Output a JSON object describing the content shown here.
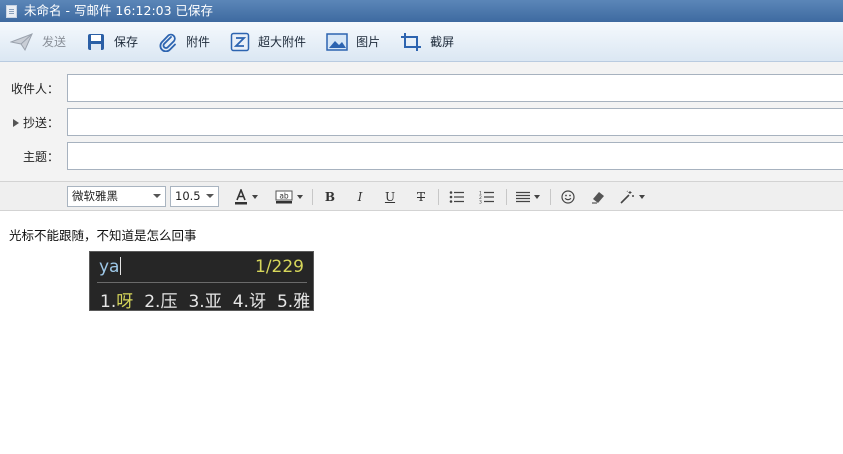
{
  "window": {
    "title": "未命名 - 写邮件   16:12:03 已保存"
  },
  "toolbar": {
    "send": "发送",
    "save": "保存",
    "attach": "附件",
    "big_attach": "超大附件",
    "image": "图片",
    "screenshot": "截屏"
  },
  "fields": {
    "to_label": "收件人：",
    "cc_label": "抄送：",
    "subject_label": "主题：",
    "to_value": "",
    "cc_value": "",
    "subject_value": ""
  },
  "format": {
    "font_family": "微软雅黑",
    "font_size": "10.5",
    "bold": "B",
    "italic": "I",
    "underline": "U",
    "strike": "T"
  },
  "body": {
    "text": "光标不能跟随，不知道是怎么回事"
  },
  "ime": {
    "composition": "ya",
    "page": "1/229",
    "candidates": [
      {
        "num": "1.",
        "char": "呀"
      },
      {
        "num": "2.",
        "char": "压"
      },
      {
        "num": "3.",
        "char": "亚"
      },
      {
        "num": "4.",
        "char": "讶"
      },
      {
        "num": "5.",
        "char": "雅"
      }
    ]
  },
  "colors": {
    "titlebar": "#3e6aa0",
    "ime_bg": "#262626",
    "ime_highlight": "#d6d65a"
  }
}
